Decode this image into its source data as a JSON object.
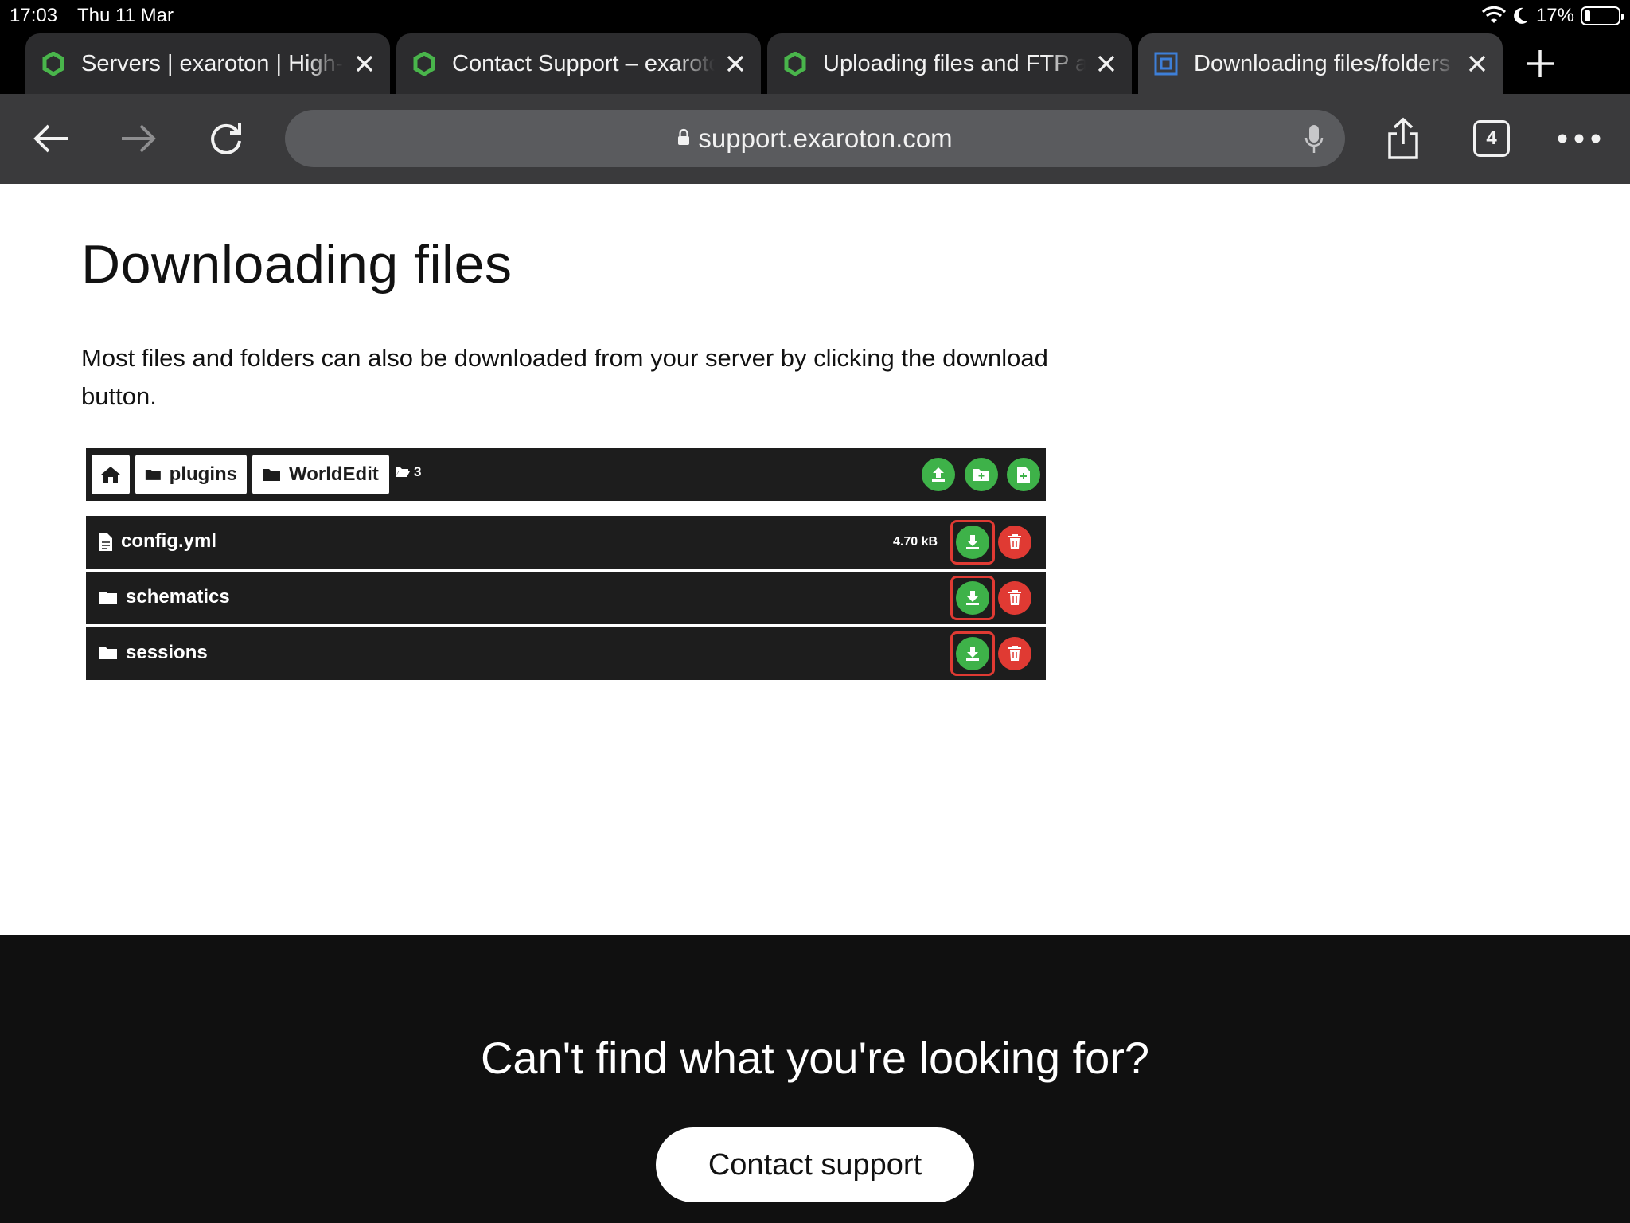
{
  "status": {
    "time": "17:03",
    "date": "Thu 11 Mar",
    "battery": "17%"
  },
  "tabs": [
    {
      "title": "Servers | exaroton | High-performance Minecraft servers",
      "favicon": "exaroton-gear-icon",
      "active": false
    },
    {
      "title": "Contact Support – exaroton",
      "favicon": "exaroton-gear-icon",
      "active": false
    },
    {
      "title": "Uploading files and FTP access",
      "favicon": "exaroton-gear-icon",
      "active": false
    },
    {
      "title": "Downloading files/folders",
      "favicon": "support-site-icon",
      "active": true
    }
  ],
  "toolbar": {
    "url": "support.exaroton.com",
    "tab_count": "4"
  },
  "article": {
    "heading": "Downloading files",
    "paragraph": "Most files and folders can also be downloaded from your server by clicking the download button."
  },
  "file_manager": {
    "breadcrumbs": [
      "plugins",
      "WorldEdit"
    ],
    "item_count": "3",
    "rows": [
      {
        "name": "config.yml",
        "type": "file",
        "size": "4.70 kB"
      },
      {
        "name": "schematics",
        "type": "folder",
        "size": ""
      },
      {
        "name": "sessions",
        "type": "folder",
        "size": ""
      }
    ]
  },
  "footer": {
    "question": "Can't find what you're looking for?",
    "button": "Contact support"
  },
  "colors": {
    "green": "#3eb249",
    "red": "#e03a33",
    "footer_bg": "#101010",
    "toolbar_bg": "#3a3a3c"
  }
}
